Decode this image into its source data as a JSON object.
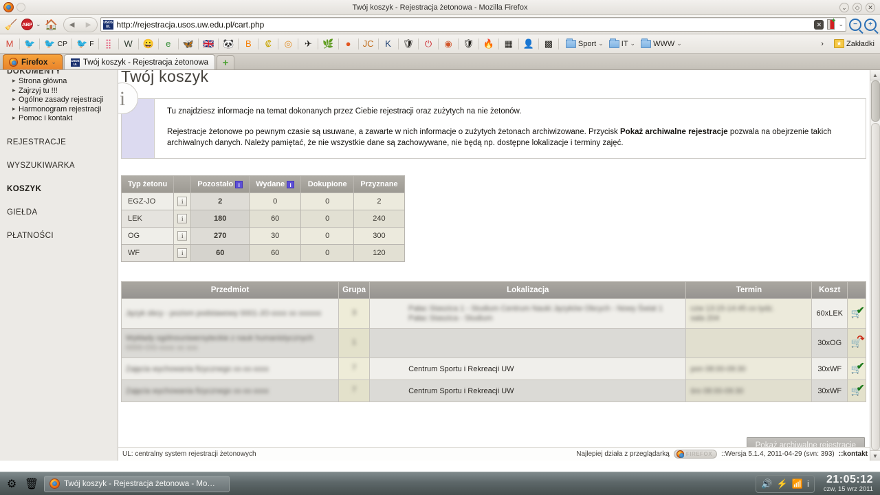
{
  "window": {
    "title": "Twój koszyk - Rejestracja żetonowa - Mozilla Firefox",
    "minimize": "⌄",
    "maximize": "◇",
    "close": "✕"
  },
  "navbar": {
    "url": "http://rejestracja.usos.uw.edu.pl/cart.php",
    "broom_icon": "broom-icon",
    "abp_label": "ABP",
    "home_icon": "🏠",
    "back_icon": "◄",
    "forward_icon": "►",
    "favicon_text": "USOS UL",
    "clear_icon": "✕",
    "zoom_out": "−",
    "zoom_in": "+",
    "dropdown_caret": "⌄"
  },
  "bookmarks": {
    "items": [
      {
        "name": "gmail",
        "glyph": "M",
        "label": "",
        "color": "#d44638"
      },
      {
        "name": "pidgin-1",
        "glyph": "🐦",
        "label": ""
      },
      {
        "name": "pidgin-cp",
        "glyph": "🐦",
        "label": "CP"
      },
      {
        "name": "pidgin-f",
        "glyph": "🐦",
        "label": "F"
      },
      {
        "name": "dots",
        "glyph": "⣿",
        "label": "",
        "color": "#e34b6e"
      },
      {
        "name": "wikipedia",
        "glyph": "W",
        "label": "",
        "color": "#2f3b2f"
      },
      {
        "name": "smiley",
        "glyph": "😀",
        "label": ""
      },
      {
        "name": "ebay",
        "glyph": "e",
        "label": "",
        "color": "#3a8f3a"
      },
      {
        "name": "moth",
        "glyph": "🦋",
        "label": ""
      },
      {
        "name": "uk-flag",
        "glyph": "🇬🇧",
        "label": ""
      },
      {
        "name": "panda",
        "glyph": "🐼",
        "label": ""
      },
      {
        "name": "blogger",
        "glyph": "B",
        "label": "",
        "color": "#f57c00"
      },
      {
        "name": "currency",
        "glyph": "₡",
        "label": "",
        "color": "#c8a400"
      },
      {
        "name": "winamp",
        "glyph": "◎",
        "label": "",
        "color": "#e08a1e"
      },
      {
        "name": "plane",
        "glyph": "✈",
        "label": ""
      },
      {
        "name": "leaf",
        "glyph": "🌿",
        "label": ""
      },
      {
        "name": "orange-dot",
        "glyph": "●",
        "label": "",
        "color": "#e2551f"
      },
      {
        "name": "jc",
        "glyph": "JC",
        "label": "",
        "color": "#c06a16"
      },
      {
        "name": "kde",
        "glyph": "K",
        "label": "",
        "color": "#1d3f73"
      },
      {
        "name": "shield-blue",
        "glyph": "🛡",
        "label": ""
      },
      {
        "name": "power",
        "glyph": "⏻",
        "label": "",
        "color": "#cc2027"
      },
      {
        "name": "wifi",
        "glyph": "◉",
        "label": "",
        "color": "#d1562b"
      },
      {
        "name": "shield",
        "glyph": "🛡",
        "label": ""
      },
      {
        "name": "flame",
        "glyph": "🔥",
        "label": ""
      },
      {
        "name": "photo",
        "glyph": "▦",
        "label": ""
      },
      {
        "name": "person",
        "glyph": "👤",
        "label": "",
        "color": "#b03a4a"
      },
      {
        "name": "puzzle",
        "glyph": "▩",
        "label": ""
      }
    ],
    "folders": [
      {
        "label": "Sport"
      },
      {
        "label": "IT"
      },
      {
        "label": "WWW"
      }
    ],
    "overflow_icon": "›",
    "zakladki_label": "Zakładki"
  },
  "tabs": {
    "firefox_button": "Firefox",
    "open_tab": "Twój koszyk - Rejestracja żetonowa",
    "new_tab_icon": "+"
  },
  "sidebar": {
    "header": "DOKUMENTY",
    "sub_items": [
      "Strona główna",
      "Zajrzyj tu !!!",
      "Ogólne zasady rejestracji",
      "Harmonogram rejestracji",
      "Pomoc i kontakt"
    ],
    "main_items": [
      {
        "label": "REJESTRACJE",
        "active": false
      },
      {
        "label": "WYSZUKIWARKA",
        "active": false
      },
      {
        "label": "KOSZYK",
        "active": true
      },
      {
        "label": "GIEŁDA",
        "active": false
      },
      {
        "label": "PŁATNOŚCI",
        "active": false
      }
    ]
  },
  "main": {
    "title": "Twój koszyk",
    "info": {
      "icon": "i",
      "para1": "Tu znajdziesz informacje na temat dokonanych przez Ciebie rejestracji oraz zużytych na nie żetonów.",
      "para2_a": "Rejestracje żetonowe po pewnym czasie są usuwane, a zawarte w nich informacje o zużytych żetonach archiwizowane. Przycisk ",
      "para2_bold": "Pokaż archiwalne rejestracje",
      "para2_b": " pozwala na obejrzenie takich archiwalnych danych. Należy pamiętać, że nie wszystkie dane są zachowywane, nie będą np. dostępne lokalizacje i terminy zajęć."
    },
    "token_table": {
      "headers": [
        "Typ żetonu",
        "",
        "Pozostało",
        "Wydane",
        "Dokupione",
        "Przyznane"
      ],
      "info_badge": "i",
      "row_info_icon": "i",
      "rows": [
        {
          "type": "EGZ-JO",
          "left": "2",
          "used": "0",
          "bought": "0",
          "given": "2"
        },
        {
          "type": "LEK",
          "left": "180",
          "used": "60",
          "bought": "0",
          "given": "240"
        },
        {
          "type": "OG",
          "left": "270",
          "used": "30",
          "bought": "0",
          "given": "300"
        },
        {
          "type": "WF",
          "left": "60",
          "used": "60",
          "bought": "0",
          "given": "120"
        }
      ]
    },
    "courses_table": {
      "headers": [
        "Przedmiot",
        "Grupa",
        "Lokalizacja",
        "Termin",
        "Koszt",
        ""
      ],
      "rows": [
        {
          "subject_redacted": "Język obcy - poziom podstawowy 0001-JO-xxxx xx xxxxxx",
          "subject_redacted2": "",
          "group_redacted": "3",
          "location_redacted": "Pałac Staszica 1 - Studium Centrum Nauki Języków Obcych - Nowy Świat 1",
          "location_redacted2": "Pałac Staszica - Studium",
          "term_redacted": "czw 13:15-14:45 co tydz.",
          "term_redacted2": "sala 204",
          "cost": "60xLEK",
          "action_icon": "cart-check-icon"
        },
        {
          "subject_redacted": "Wykłady ogólnouniwersyteckie z nauk humanistycznych",
          "subject_redacted2": "0000-OG-xxxx xx xxx",
          "group_redacted": "1",
          "location_redacted": "",
          "location_redacted2": "",
          "term_redacted": "",
          "term_redacted2": "",
          "cost": "30xOG",
          "action_icon": "cart-undo-icon"
        },
        {
          "subject_redacted": "Zajęcia wychowania fizycznego xx-xx-xxxx",
          "subject_redacted2": "",
          "group_redacted": "7",
          "location": "Centrum Sportu i Rekreacji UW",
          "term_redacted": "pon 08:00-09:30",
          "term_redacted2": "",
          "cost": "30xWF",
          "action_icon": "cart-check-icon"
        },
        {
          "subject_redacted": "Zajęcia wychowania fizycznego xx-xx-xxxx",
          "subject_redacted2": "",
          "group_redacted": "7",
          "location": "Centrum Sportu i Rekreacji UW",
          "term_redacted": "śro 08:00-09:30",
          "term_redacted2": "",
          "cost": "30xWF",
          "action_icon": "cart-check-icon"
        }
      ]
    },
    "archive_button": "Pokaż archiwalne rejestracje"
  },
  "page_footer": {
    "left": "UL: centralny system rejestracji żetonowych",
    "best_with": "Najlepiej działa z przeglądarką",
    "browser_pill": "FIREFOX",
    "version": "::Wersja 5.1.4, 2011-04-29 (svn: 393)",
    "contact": "::kontakt"
  },
  "taskbar": {
    "menu_icon": "gear-icon",
    "trash_icon": "trash-icon",
    "window_label": "Twój koszyk - Rejestracja żetonowa - Mo…",
    "tray": [
      {
        "name": "volume-icon",
        "glyph": "🔊"
      },
      {
        "name": "battery-icon",
        "glyph": "⚡"
      },
      {
        "name": "network-icon",
        "glyph": "📶"
      },
      {
        "name": "info-icon",
        "glyph": "i"
      }
    ],
    "time": "21:05:12",
    "date": "czw, 15 wrz 2011"
  },
  "colors": {
    "accent_orange": "#e8832a",
    "badge_purple": "#5d4fd6",
    "table_header_gray": "#a09d96",
    "info_panel_lilac": "#dcdaf0",
    "cart_check_green": "#1a7a1a",
    "cart_undo_red": "#cc2b17"
  }
}
